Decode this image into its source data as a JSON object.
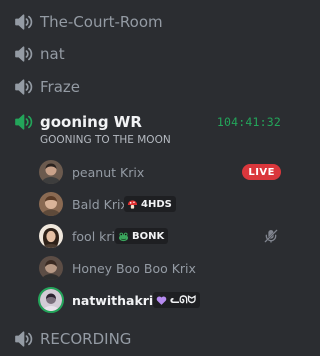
{
  "channels_top": [
    {
      "name": "The-Court-Room",
      "icon": "speaker-icon"
    },
    {
      "name": "nat",
      "icon": "speaker-icon"
    },
    {
      "name": "Fraze",
      "icon": "speaker-icon"
    }
  ],
  "active_channel": {
    "name": "gooning WR",
    "icon": "speaker-icon",
    "timer": "104:41:32",
    "status": "GOONING TO THE MOON"
  },
  "users": [
    {
      "name": "peanut Krix",
      "badge": "LIVE"
    },
    {
      "name": "Bald Krix",
      "tag": {
        "icon": "mushroom-icon",
        "label": "4HDS"
      }
    },
    {
      "name": "fool krix",
      "tag": {
        "icon": "frog-icon",
        "label": "BONK"
      },
      "status_icon": "deafened-icon"
    },
    {
      "name": "Honey Boo Boo Krix"
    },
    {
      "name": "natwithakrix",
      "tag": {
        "icon": "purple-heart-icon",
        "label": "ᓚᘏᗢ"
      }
    }
  ],
  "channels_bottom": [
    {
      "name": "RECORDING",
      "icon": "speaker-icon"
    }
  ],
  "colors": {
    "background": "#2b2d31",
    "muted_text": "#949ba4",
    "bright_text": "#f2f3f5",
    "online_green": "#23a55a",
    "live_red": "#da373c",
    "tag_bg": "#1e1f22"
  }
}
